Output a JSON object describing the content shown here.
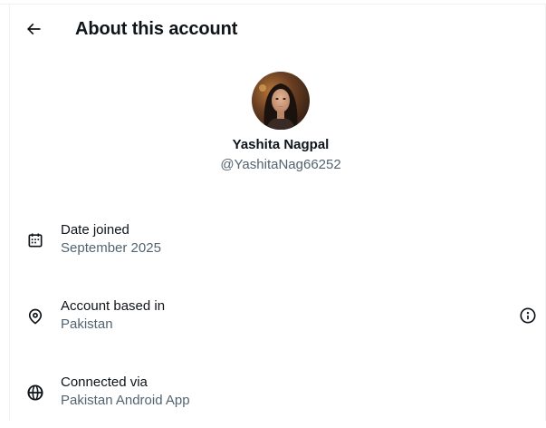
{
  "header": {
    "title": "About this account",
    "back_icon": "arrow-left-icon"
  },
  "profile": {
    "display_name": "Yashita Nagpal",
    "handle": "@YashitaNag66252"
  },
  "rows": [
    {
      "icon": "calendar-icon",
      "label": "Date joined",
      "value": "September 2025"
    },
    {
      "icon": "location-pin-icon",
      "label": "Account based in",
      "value": "Pakistan",
      "trailing_icon": "info-icon"
    },
    {
      "icon": "globe-icon",
      "label": "Connected via",
      "value": "Pakistan Android App"
    }
  ],
  "colors": {
    "primary_text": "#0f1419",
    "secondary_text": "#536471",
    "divider": "#eff3f4"
  }
}
